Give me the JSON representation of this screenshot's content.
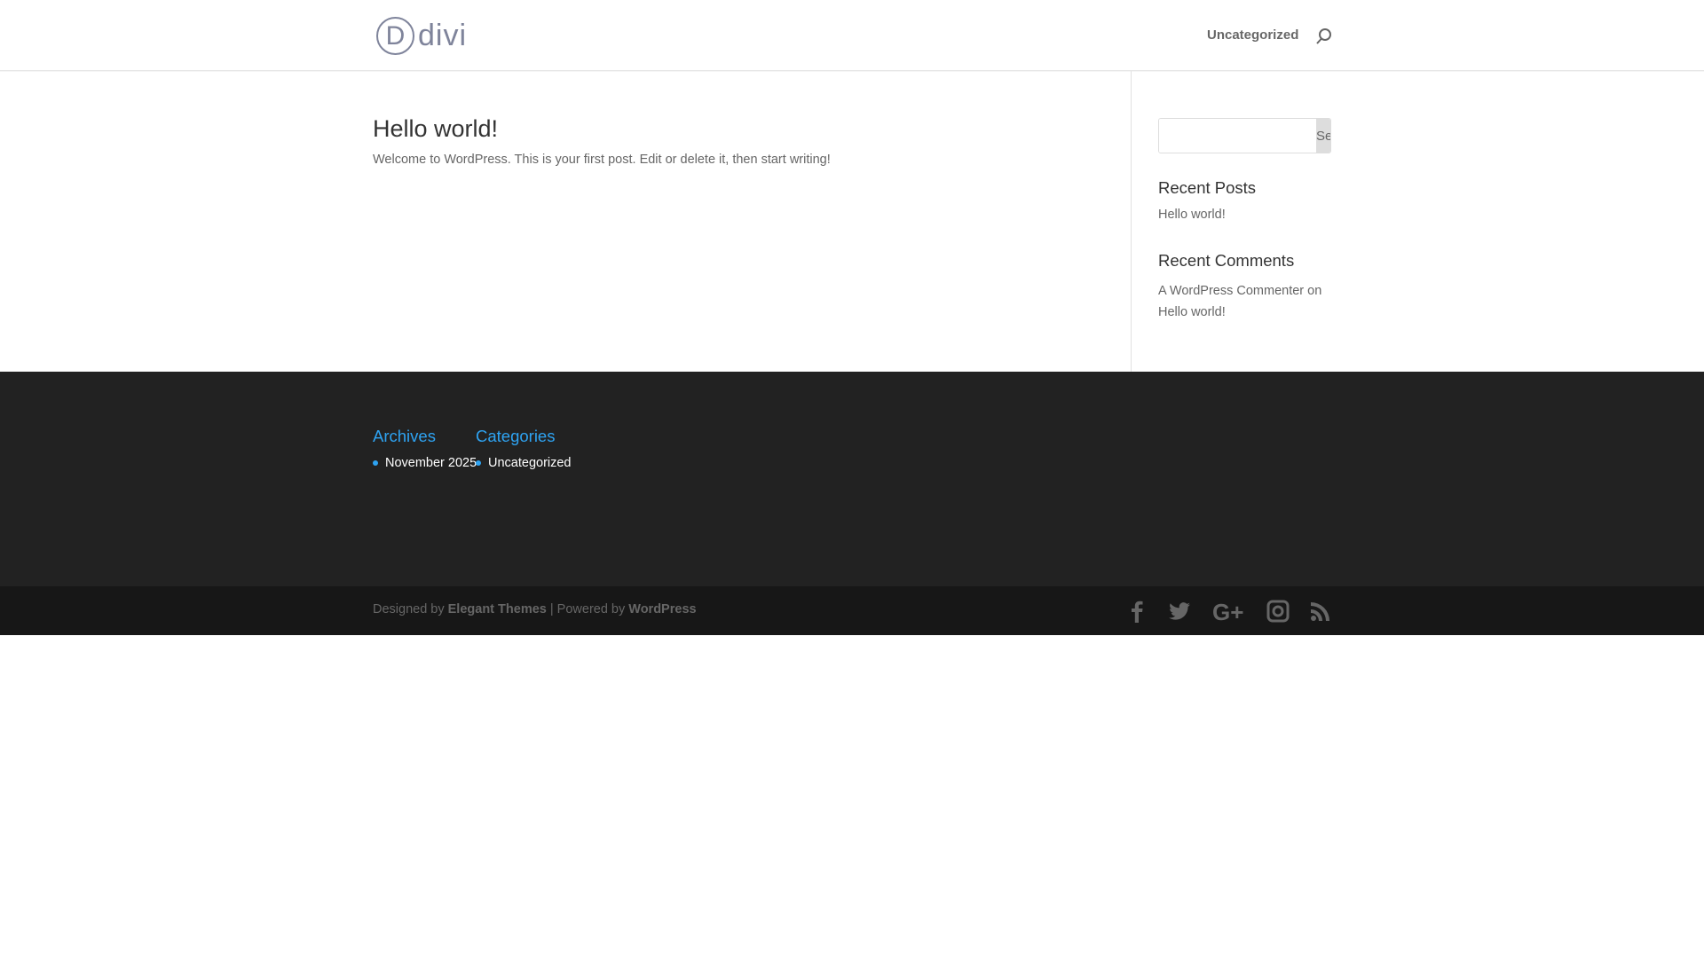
{
  "header": {
    "logo_text": "divi",
    "logo_letter": "D",
    "nav": [
      {
        "label": "Uncategorized"
      }
    ]
  },
  "post": {
    "title": "Hello world!",
    "excerpt": "Welcome to WordPress. This is your first post. Edit or delete it, then start writing!"
  },
  "sidebar": {
    "search": {
      "button_label": "Search",
      "value": ""
    },
    "recent_posts": {
      "title": "Recent Posts",
      "items": [
        "Hello world!"
      ]
    },
    "recent_comments": {
      "title": "Recent Comments",
      "author": "A WordPress Commenter",
      "on": "on",
      "post": "Hello world!"
    }
  },
  "footer": {
    "archives": {
      "title": "Archives",
      "items": [
        "November 2025"
      ]
    },
    "categories": {
      "title": "Categories",
      "items": [
        "Uncategorized"
      ]
    },
    "credits": {
      "designed_by": "Designed by",
      "elegant": "Elegant Themes",
      "sep": "| Powered by",
      "wordpress": "WordPress"
    },
    "social": [
      "facebook-icon",
      "twitter-icon",
      "google-plus-icon",
      "instagram-icon",
      "rss-icon"
    ]
  },
  "colors": {
    "accent": "#2ea3f2",
    "footer_bg": "#222222",
    "bottom_bg": "#171717"
  }
}
